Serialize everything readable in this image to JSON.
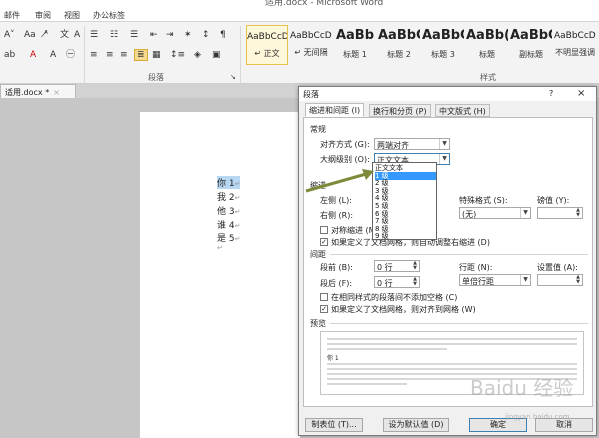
{
  "window_title": "适用.docx - Microsoft Word",
  "menu": [
    "邮件",
    "审阅",
    "视图",
    "办公标签"
  ],
  "ribbon": {
    "paragraph_group": "段落",
    "styles_group": "样式",
    "styles": [
      {
        "preview": "AaBbCcDd",
        "name": "↵ 正文",
        "big": false,
        "selected": true
      },
      {
        "preview": "AaBbCcDd",
        "name": "↵ 无间隔",
        "big": false,
        "selected": false
      },
      {
        "preview": "AaBb",
        "name": "标题 1",
        "big": true,
        "selected": false
      },
      {
        "preview": "AaBbC",
        "name": "标题 2",
        "big": true,
        "selected": false
      },
      {
        "preview": "AaBbC",
        "name": "标题 3",
        "big": true,
        "selected": false
      },
      {
        "preview": "AaBb(",
        "name": "标题",
        "big": true,
        "selected": false
      },
      {
        "preview": "AaBbC",
        "name": "副标题",
        "big": true,
        "selected": false
      },
      {
        "preview": "AaBbCcDd",
        "name": "不明显强调",
        "big": false,
        "selected": false
      }
    ]
  },
  "doc_tab": {
    "label": "适用.docx *",
    "close": "×"
  },
  "document": {
    "lines": [
      "你 1",
      "我 2",
      "他 3",
      "谁 4",
      "是 5"
    ],
    "para_mark": "↵"
  },
  "dialog": {
    "title": "段落",
    "help": "?",
    "close": "×",
    "tabs": [
      "缩进和间距 (I)",
      "换行和分页 (P)",
      "中文版式 (H)"
    ],
    "general": {
      "section": "常规",
      "alignment_label": "对齐方式 (G):",
      "alignment_value": "两端对齐",
      "outline_label": "大纲级别 (O):",
      "outline_value": "正文文本"
    },
    "outline_options": [
      "正文文本",
      "1 级",
      "2 级",
      "3 级",
      "4 级",
      "5 级",
      "6 级",
      "7 级",
      "8 级",
      "9 级"
    ],
    "outline_highlighted": "1 级",
    "indent": {
      "section": "缩进",
      "left_label": "左侧 (L):",
      "right_label": "右侧 (R):",
      "special_label": "特殊格式 (S):",
      "special_value": "(无)",
      "by_label": "磅值 (Y):",
      "mirror_label": "对称缩进 (M)",
      "grid_label": "如果定义了文档网格，则自动调整右缩进 (D)",
      "grid_checked": true
    },
    "spacing": {
      "section": "间距",
      "before_label": "段前 (B):",
      "before_value": "0 行",
      "after_label": "段后 (F):",
      "after_value": "0 行",
      "line_label": "行距 (N):",
      "line_value": "单倍行距",
      "at_label": "设置值 (A):",
      "no_space_label": "在相同样式的段落间不添加空格 (C)",
      "snap_label": "如果定义了文档网格，则对齐到网格 (W)",
      "snap_checked": true
    },
    "preview": {
      "section": "预览",
      "sample": "你 1"
    },
    "buttons": {
      "tabs": "制表位 (T)...",
      "default": "设为默认值 (D)",
      "ok": "确定",
      "cancel": "取消"
    }
  },
  "watermark": {
    "text": "Baidu 经验",
    "sub": "jingyan.baidu.com"
  },
  "colors": {
    "highlight": "#3399ff",
    "arrow": "#7d8a3a",
    "selection": "#b8d7f2"
  }
}
